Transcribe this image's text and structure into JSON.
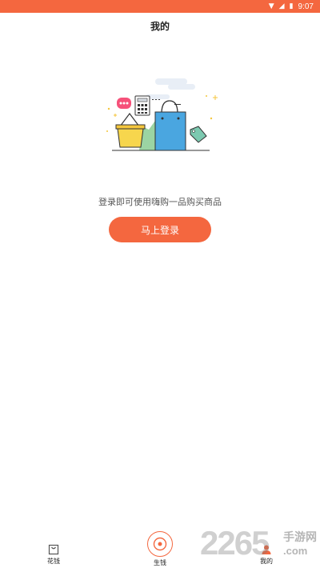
{
  "status_bar": {
    "time": "9:07",
    "icons": [
      "wifi-icon",
      "signal-icon",
      "battery-icon"
    ]
  },
  "header": {
    "title": "我的"
  },
  "main": {
    "illustration": "shopping-illustration",
    "login_hint": "登录即可使用嗨购一品购买商品",
    "login_button_label": "马上登录"
  },
  "tab_bar": {
    "tabs": [
      {
        "label": "花钱",
        "icon": "bag-icon"
      },
      {
        "label": "生钱",
        "icon": "target-icon"
      },
      {
        "label": "我的",
        "icon": "person-icon"
      }
    ]
  },
  "watermark": {
    "number": "2265",
    "text": "手游网",
    "domain": ".com"
  },
  "colors": {
    "accent": "#f4673f",
    "text": "#333333"
  }
}
